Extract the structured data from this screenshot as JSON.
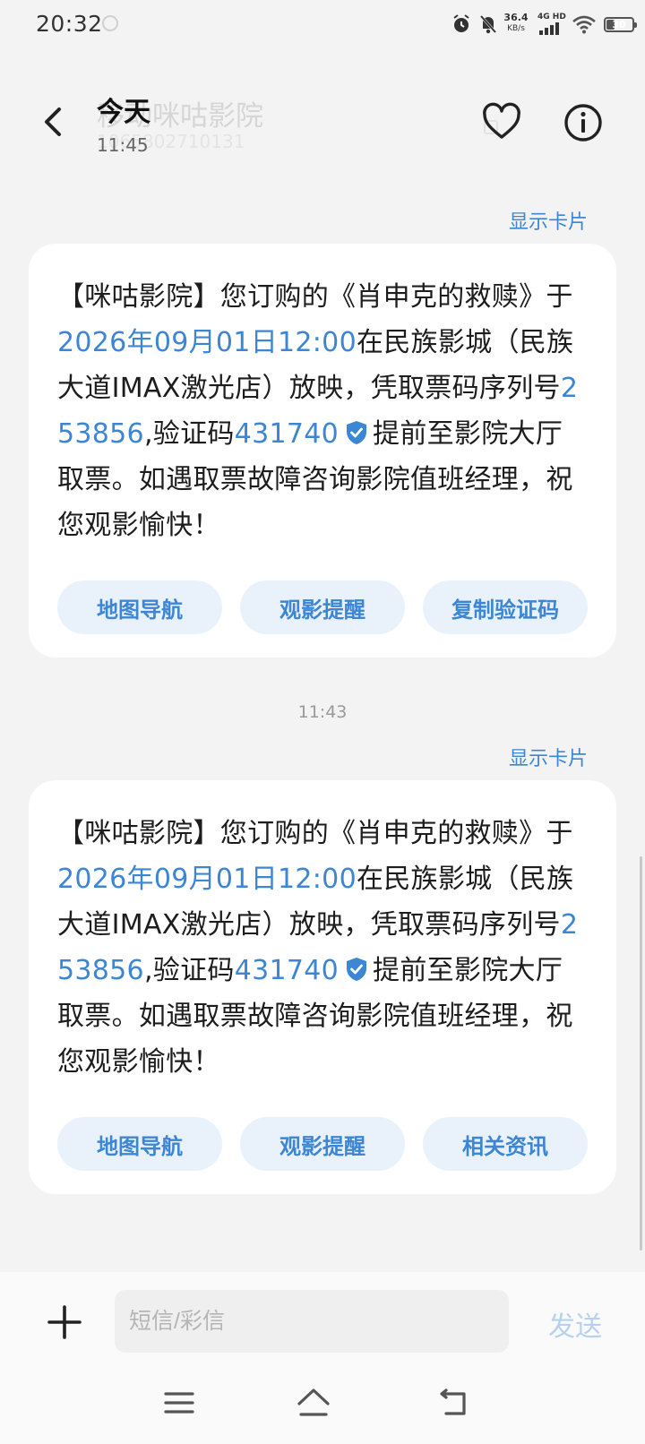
{
  "status_bar": {
    "time": "20:32",
    "net_speed": "36.4",
    "net_speed_unit": "KB/s",
    "network": "4G HD",
    "battery": "30"
  },
  "header": {
    "title": "今天",
    "time": "11:45",
    "ghost_title": "移动咪咕影院",
    "ghost_subtitle": "1065802710131"
  },
  "messages": [
    {
      "show_card_label": "显示卡片",
      "parts": {
        "p1": "【咪咕影院】您订购的《肖申克的救赎》于",
        "datetime": "2026年09月01日12:00",
        "p2": "在民族影城（民族大道IMAX激光店）放映，凭取票码序列号",
        "serial": "253856",
        "p3": ",验证码",
        "code": "431740",
        "p4": "提前至影院大厅取票。如遇取票故障咨询影院值班经理，祝您观影愉快！"
      },
      "actions": [
        "地图导航",
        "观影提醒",
        "复制验证码"
      ]
    },
    {
      "time_separator": "11:43",
      "show_card_label": "显示卡片",
      "parts": {
        "p1": "【咪咕影院】您订购的《肖申克的救赎》于",
        "datetime": "2026年09月01日12:00",
        "p2": "在民族影城（民族大道IMAX激光店）放映，凭取票码序列号",
        "serial": "253856",
        "p3": ",验证码",
        "code": "431740",
        "p4": "提前至影院大厅取票。如遇取票故障咨询影院值班经理，祝您观影愉快！"
      },
      "actions": [
        "地图导航",
        "观影提醒",
        "相关资讯"
      ]
    }
  ],
  "composer": {
    "placeholder": "短信/彩信",
    "send_label": "发送"
  },
  "colors": {
    "accent": "#3d86d3",
    "chip_bg": "#e9f1fb",
    "background": "#f3f3f3"
  },
  "icons": [
    "back-icon",
    "heart-icon",
    "info-icon",
    "verified-icon",
    "plus-icon",
    "menu-icon",
    "home-icon",
    "return-icon"
  ]
}
